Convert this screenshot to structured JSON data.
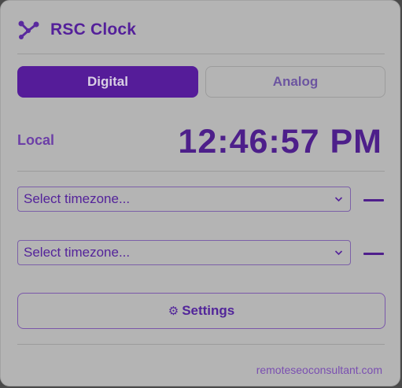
{
  "app": {
    "title": "RSC Clock",
    "logo_icon": "molecule-icon"
  },
  "modes": {
    "digital_label": "Digital",
    "analog_label": "Analog",
    "active": "Digital"
  },
  "local": {
    "label": "Local",
    "time": "12:46:57 PM"
  },
  "timezones": [
    {
      "placeholder": "Select timezone...",
      "time": "—"
    },
    {
      "placeholder": "Select timezone...",
      "time": "—"
    }
  ],
  "settings": {
    "icon": "⚙",
    "label": "Settings"
  },
  "footer": {
    "link_text": "remoteseoconsultant.com"
  },
  "colors": {
    "accent": "#551c99",
    "background": "#b4b4b4",
    "text_accent": "#54209a"
  }
}
